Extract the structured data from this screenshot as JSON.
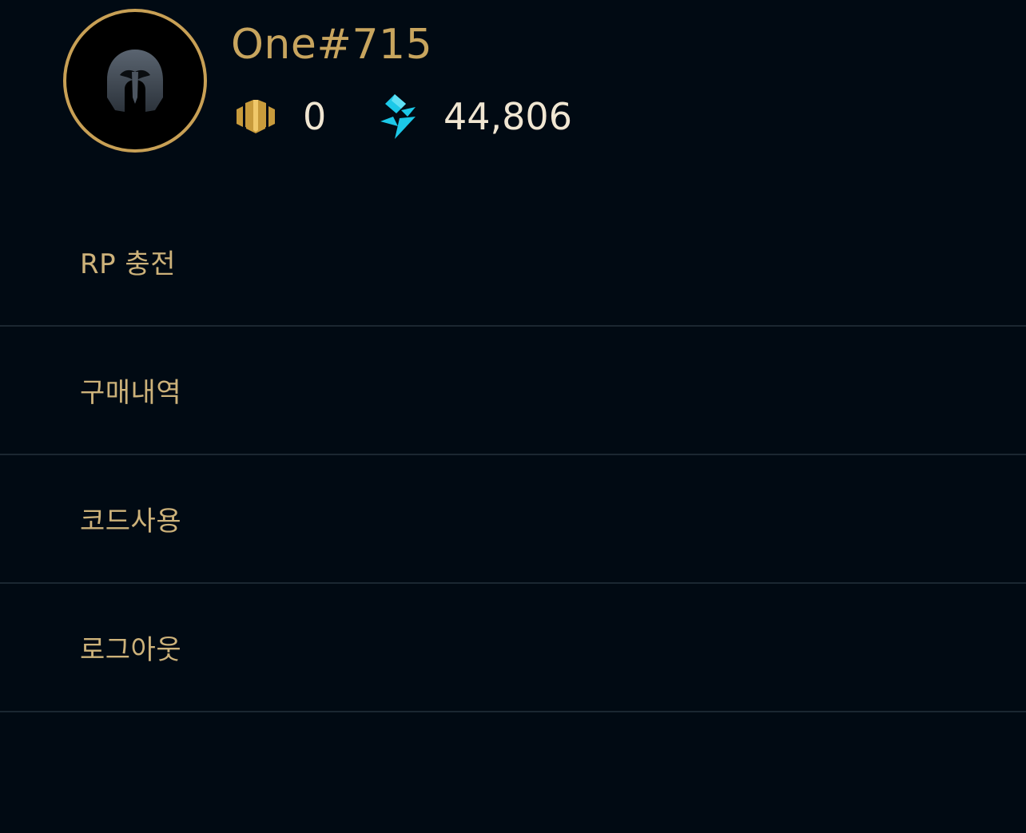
{
  "profile": {
    "username": "One#715",
    "avatar_icon": "helmet-icon"
  },
  "wallet": {
    "blue_essence": {
      "icon": "blue-essence-icon",
      "amount": "0",
      "icon_color": "#c89b3c"
    },
    "riot_points": {
      "icon": "riot-points-icon",
      "amount": "44,806",
      "icon_color": "#1cc8e8"
    }
  },
  "menu": {
    "items": [
      {
        "label": "RP 충전"
      },
      {
        "label": "구매내역"
      },
      {
        "label": "코드사용"
      },
      {
        "label": "로그아웃"
      }
    ]
  },
  "colors": {
    "background": "#010a13",
    "gold": "#c8a055",
    "menu_text": "#cdb27a",
    "amount_text": "#f0e6d2",
    "divider": "#1b2731"
  }
}
